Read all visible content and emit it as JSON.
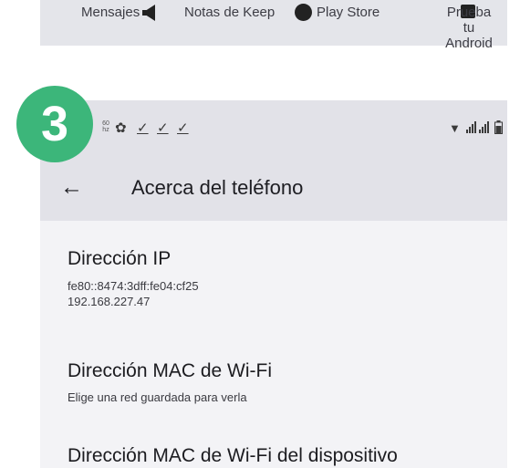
{
  "top_strip": {
    "app_labels": [
      "Mensajes",
      "Notas de Keep",
      "Play Store",
      "Prueba tu Android"
    ],
    "nav_icons": [
      "back-icon",
      "home-icon",
      "recents-icon"
    ]
  },
  "step_badge": "3",
  "status_bar": {
    "refresh_rate_top": "60",
    "refresh_rate_bottom": "hz",
    "left_icons": [
      "gear-icon",
      "download-done-icon",
      "download-done-icon",
      "download-done-icon"
    ],
    "right_icons": [
      "wifi-icon",
      "signal-icon",
      "signal-icon",
      "battery-icon"
    ],
    "gear_glyph": "✿",
    "check_glyph": "✓",
    "wifi_glyph": "▼",
    "signal_glyph": "📶"
  },
  "app_bar": {
    "back_glyph": "←",
    "title": "Acerca del teléfono"
  },
  "preferences": [
    {
      "title": "Dirección IP",
      "summary_lines": [
        "fe80::8474:3dff:fe04:cf25",
        "192.168.227.47"
      ]
    },
    {
      "title": "Dirección MAC de Wi-Fi",
      "summary_lines": [
        "Elige una red guardada para verla"
      ]
    },
    {
      "title": "Dirección MAC de Wi-Fi del dispositivo",
      "summary_lines": []
    }
  ],
  "colors": {
    "badge": "#3cb67a",
    "app_bar": "#e2e2e8",
    "background": "#f3f3f6"
  }
}
